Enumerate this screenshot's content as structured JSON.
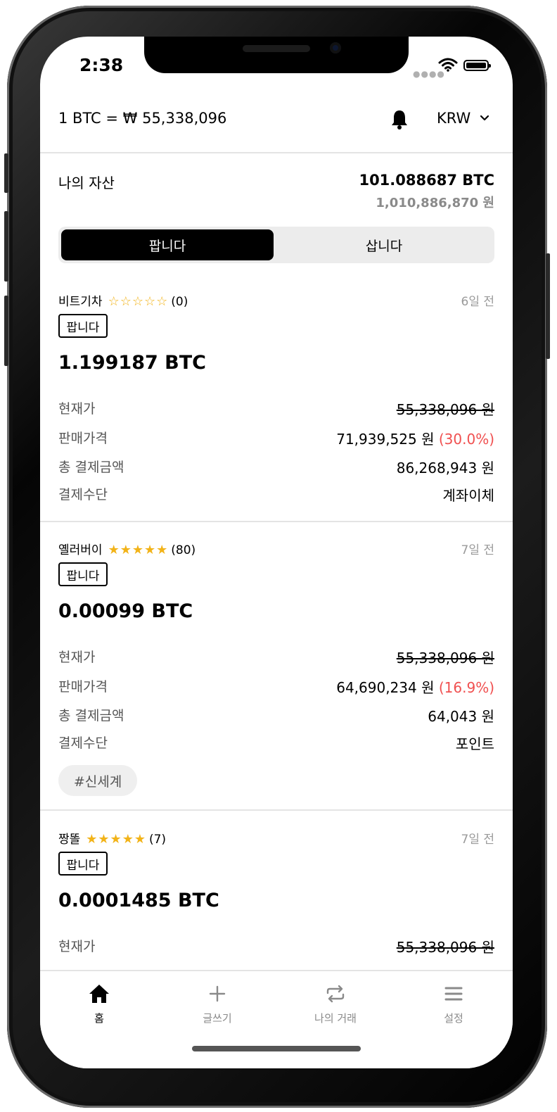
{
  "status_bar": {
    "time": "2:38"
  },
  "header": {
    "rate": "1 BTC = ₩ 55,338,096",
    "currency": "KRW"
  },
  "assets": {
    "label": "나의 자산",
    "btc": "101.088687 BTC",
    "krw": "1,010,886,870 원"
  },
  "segment": {
    "sell": "팝니다",
    "buy": "삽니다",
    "selected": "sell"
  },
  "field_labels": {
    "current": "현재가",
    "price": "판매가격",
    "total": "총 결제금액",
    "method": "결제수단"
  },
  "listings": [
    {
      "seller": "비트기차",
      "stars": "☆☆☆☆☆",
      "rating_count": "(0)",
      "ago": "6일 전",
      "tag": "팝니다",
      "amount": "1.199187 BTC",
      "current_price": "55,338,096 원",
      "sale_price": "71,939,525 원",
      "premium": "(30.0%)",
      "total": "86,268,943 원",
      "method": "계좌이체"
    },
    {
      "seller": "옐러버이",
      "stars": "★★★★★",
      "rating_count": "(80)",
      "ago": "7일 전",
      "tag": "팝니다",
      "amount": "0.00099 BTC",
      "current_price": "55,338,096 원",
      "sale_price": "64,690,234 원",
      "premium": "(16.9%)",
      "total": "64,043 원",
      "method": "포인트",
      "hashtag": "#신세계"
    },
    {
      "seller": "짱똘",
      "stars": "★★★★★",
      "rating_count": "(7)",
      "ago": "7일 전",
      "tag": "팝니다",
      "amount": "0.0001485 BTC",
      "current_price": "55,338,096 원"
    }
  ],
  "tabbar": {
    "items": [
      {
        "label": "홈",
        "icon": "home-icon",
        "active": true
      },
      {
        "label": "글쓰기",
        "icon": "plus-icon",
        "active": false
      },
      {
        "label": "나의 거래",
        "icon": "repeat-icon",
        "active": false
      },
      {
        "label": "설정",
        "icon": "menu-icon",
        "active": false
      }
    ]
  },
  "colors": {
    "accent_star": "#f2b318",
    "premium": "#f05050",
    "segment_active": "#000000"
  }
}
